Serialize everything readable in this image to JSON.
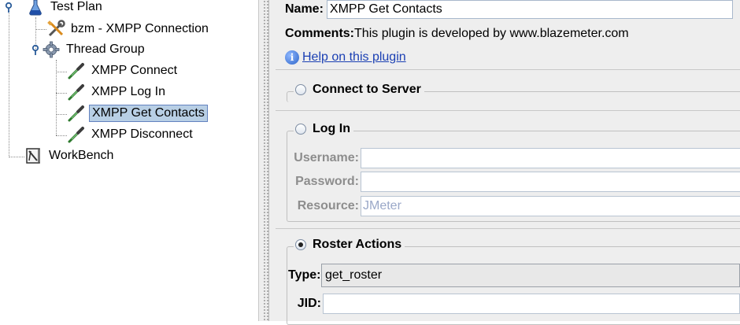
{
  "tree": {
    "test_plan": "Test Plan",
    "connection": "bzm - XMPP Connection",
    "thread_group": "Thread Group",
    "connect": "XMPP Connect",
    "login": "XMPP Log In",
    "get_contacts": "XMPP Get Contacts",
    "disconnect": "XMPP Disconnect",
    "workbench": "WorkBench"
  },
  "form": {
    "name_label": "Name:",
    "name_value": "XMPP Get Contacts",
    "comments_label": "Comments:",
    "comments_value": "This plugin is developed by www.blazemeter.com",
    "help_link": "Help on this plugin"
  },
  "connect_group": {
    "label": "Connect to Server",
    "selected": false
  },
  "login_group": {
    "label": "Log In",
    "selected": false,
    "username_label": "Username:",
    "password_label": "Password:",
    "resource_label": "Resource:",
    "resource_value": "JMeter"
  },
  "roster_group": {
    "label": "Roster Actions",
    "selected": true,
    "type_label": "Type:",
    "type_value": "get_roster",
    "jid_label": "JID:"
  },
  "colors": {
    "selection": "#b8cfe5",
    "link": "#1a3fb3",
    "panel": "#eeeeee"
  }
}
